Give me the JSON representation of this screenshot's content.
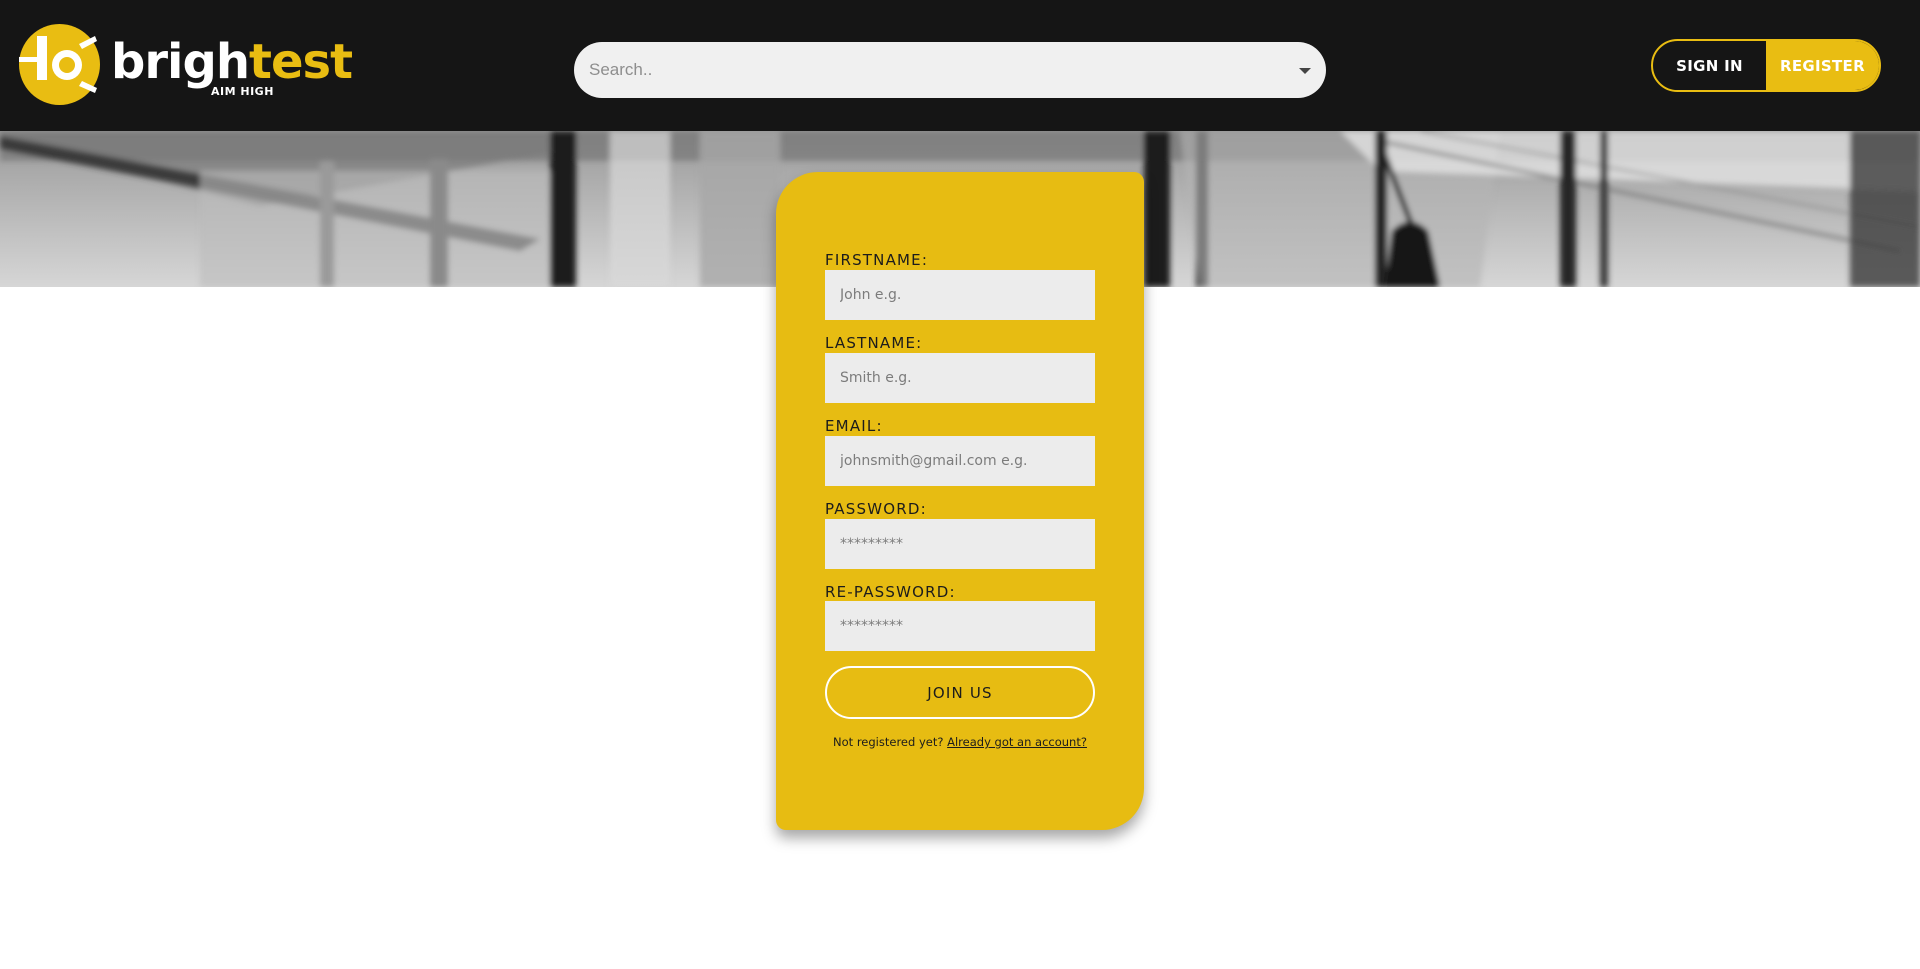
{
  "brand": {
    "name_part1": "brigh",
    "name_part2": "test",
    "tagline": "AIM HIGH",
    "colors": {
      "accent": "#e9bd12",
      "header_bg": "#151515",
      "card_bg": "#e7bc12"
    }
  },
  "search": {
    "placeholder": "Search..",
    "icon": "chevron-down-icon"
  },
  "auth": {
    "signin_label": "SIGN IN",
    "register_label": "REGISTER"
  },
  "form": {
    "firstname": {
      "label": "FIRSTNAME:",
      "placeholder": "John e.g."
    },
    "lastname": {
      "label": "LASTNAME:",
      "placeholder": "Smith e.g."
    },
    "email": {
      "label": "EMAIL:",
      "placeholder": "johnsmith@gmail.com e.g."
    },
    "password": {
      "label": "PASSWORD:",
      "placeholder": "*********"
    },
    "repassword": {
      "label": "RE-PASSWORD:",
      "placeholder": "*********"
    },
    "submit_label": "JOIN US",
    "footer_text": "Not registered yet? ",
    "footer_link": "Already got an account?"
  }
}
